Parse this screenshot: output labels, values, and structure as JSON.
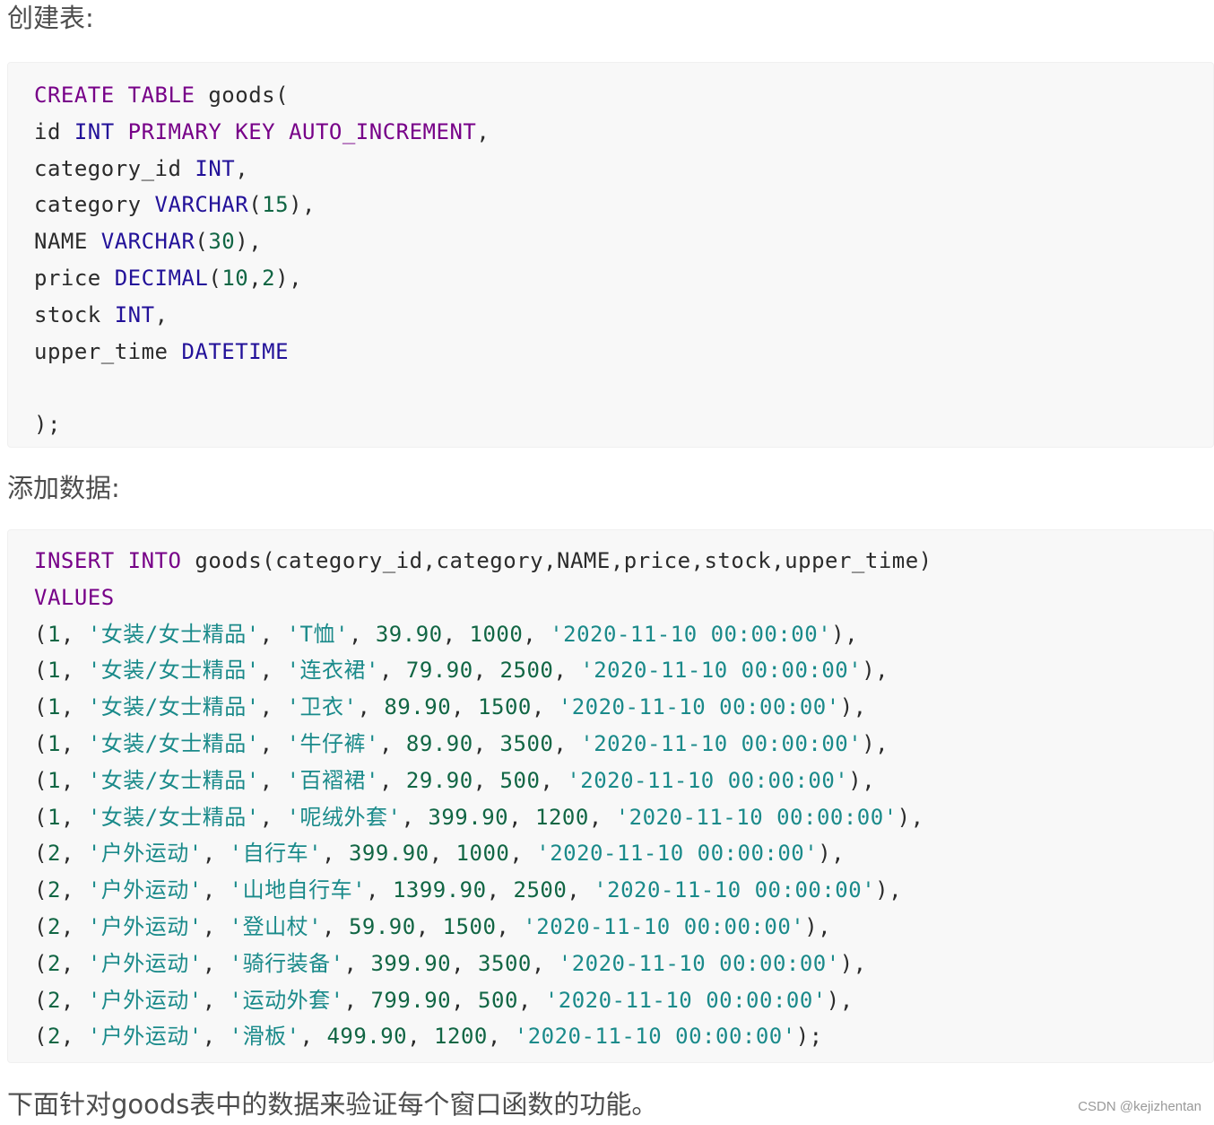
{
  "headings": {
    "create": "创建表:",
    "insert": "添加数据:",
    "closing": "下面针对goods表中的数据来验证每个窗口函数的功能。"
  },
  "create_code": [
    [
      {
        "t": "kw",
        "v": "CREATE TABLE"
      },
      {
        "t": "ident",
        "v": " goods("
      }
    ],
    [
      {
        "t": "ident",
        "v": "id "
      },
      {
        "t": "ty",
        "v": "INT"
      },
      {
        "t": "ident",
        "v": " "
      },
      {
        "t": "kw",
        "v": "PRIMARY KEY AUTO_INCREMENT"
      },
      {
        "t": "ident",
        "v": ","
      }
    ],
    [
      {
        "t": "ident",
        "v": "category_id "
      },
      {
        "t": "ty",
        "v": "INT"
      },
      {
        "t": "ident",
        "v": ","
      }
    ],
    [
      {
        "t": "ident",
        "v": "category "
      },
      {
        "t": "ty",
        "v": "VARCHAR"
      },
      {
        "t": "ident",
        "v": "("
      },
      {
        "t": "num",
        "v": "15"
      },
      {
        "t": "ident",
        "v": "),"
      }
    ],
    [
      {
        "t": "ident",
        "v": "NAME "
      },
      {
        "t": "ty",
        "v": "VARCHAR"
      },
      {
        "t": "ident",
        "v": "("
      },
      {
        "t": "num",
        "v": "30"
      },
      {
        "t": "ident",
        "v": "),"
      }
    ],
    [
      {
        "t": "ident",
        "v": "price "
      },
      {
        "t": "ty",
        "v": "DECIMAL"
      },
      {
        "t": "ident",
        "v": "("
      },
      {
        "t": "num",
        "v": "10"
      },
      {
        "t": "ident",
        "v": ","
      },
      {
        "t": "num",
        "v": "2"
      },
      {
        "t": "ident",
        "v": "),"
      }
    ],
    [
      {
        "t": "ident",
        "v": "stock "
      },
      {
        "t": "ty",
        "v": "INT"
      },
      {
        "t": "ident",
        "v": ","
      }
    ],
    [
      {
        "t": "ident",
        "v": "upper_time "
      },
      {
        "t": "ty",
        "v": "DATETIME"
      }
    ],
    [
      {
        "t": "ident",
        "v": ""
      }
    ],
    [
      {
        "t": "ident",
        "v": ");"
      }
    ]
  ],
  "insert_header": [
    [
      {
        "t": "kw",
        "v": "INSERT INTO"
      },
      {
        "t": "ident",
        "v": " goods(category_id,category,NAME,price,stock,upper_time)"
      }
    ],
    [
      {
        "t": "kw",
        "v": "VALUES"
      }
    ]
  ],
  "rows": [
    {
      "cat_id": "1",
      "category": "'女装/女士精品'",
      "name": "'T恤'",
      "price": "39.90",
      "stock": "1000",
      "time": "'2020-11-10 00:00:00'",
      "end": "),"
    },
    {
      "cat_id": "1",
      "category": "'女装/女士精品'",
      "name": "'连衣裙'",
      "price": "79.90",
      "stock": "2500",
      "time": "'2020-11-10 00:00:00'",
      "end": "),"
    },
    {
      "cat_id": "1",
      "category": "'女装/女士精品'",
      "name": "'卫衣'",
      "price": "89.90",
      "stock": "1500",
      "time": "'2020-11-10 00:00:00'",
      "end": "),"
    },
    {
      "cat_id": "1",
      "category": "'女装/女士精品'",
      "name": "'牛仔裤'",
      "price": "89.90",
      "stock": "3500",
      "time": "'2020-11-10 00:00:00'",
      "end": "),"
    },
    {
      "cat_id": "1",
      "category": "'女装/女士精品'",
      "name": "'百褶裙'",
      "price": "29.90",
      "stock": "500",
      "time": "'2020-11-10 00:00:00'",
      "end": "),"
    },
    {
      "cat_id": "1",
      "category": "'女装/女士精品'",
      "name": "'呢绒外套'",
      "price": "399.90",
      "stock": "1200",
      "time": "'2020-11-10 00:00:00'",
      "end": "),"
    },
    {
      "cat_id": "2",
      "category": "'户外运动'",
      "name": "'自行车'",
      "price": "399.90",
      "stock": "1000",
      "time": "'2020-11-10 00:00:00'",
      "end": "),"
    },
    {
      "cat_id": "2",
      "category": "'户外运动'",
      "name": "'山地自行车'",
      "price": "1399.90",
      "stock": "2500",
      "time": "'2020-11-10 00:00:00'",
      "end": "),"
    },
    {
      "cat_id": "2",
      "category": "'户外运动'",
      "name": "'登山杖'",
      "price": "59.90",
      "stock": "1500",
      "time": "'2020-11-10 00:00:00'",
      "end": "),"
    },
    {
      "cat_id": "2",
      "category": "'户外运动'",
      "name": "'骑行装备'",
      "price": "399.90",
      "stock": "3500",
      "time": "'2020-11-10 00:00:00'",
      "end": "),"
    },
    {
      "cat_id": "2",
      "category": "'户外运动'",
      "name": "'运动外套'",
      "price": "799.90",
      "stock": "500",
      "time": "'2020-11-10 00:00:00'",
      "end": "),"
    },
    {
      "cat_id": "2",
      "category": "'户外运动'",
      "name": "'滑板'",
      "price": "499.90",
      "stock": "1200",
      "time": "'2020-11-10 00:00:00'",
      "end": ");"
    }
  ],
  "watermark": "CSDN @kejizhentan",
  "colors": {
    "keyword": "#770088",
    "type": "#221199",
    "number": "#116644",
    "string": "#1a8a8a"
  }
}
